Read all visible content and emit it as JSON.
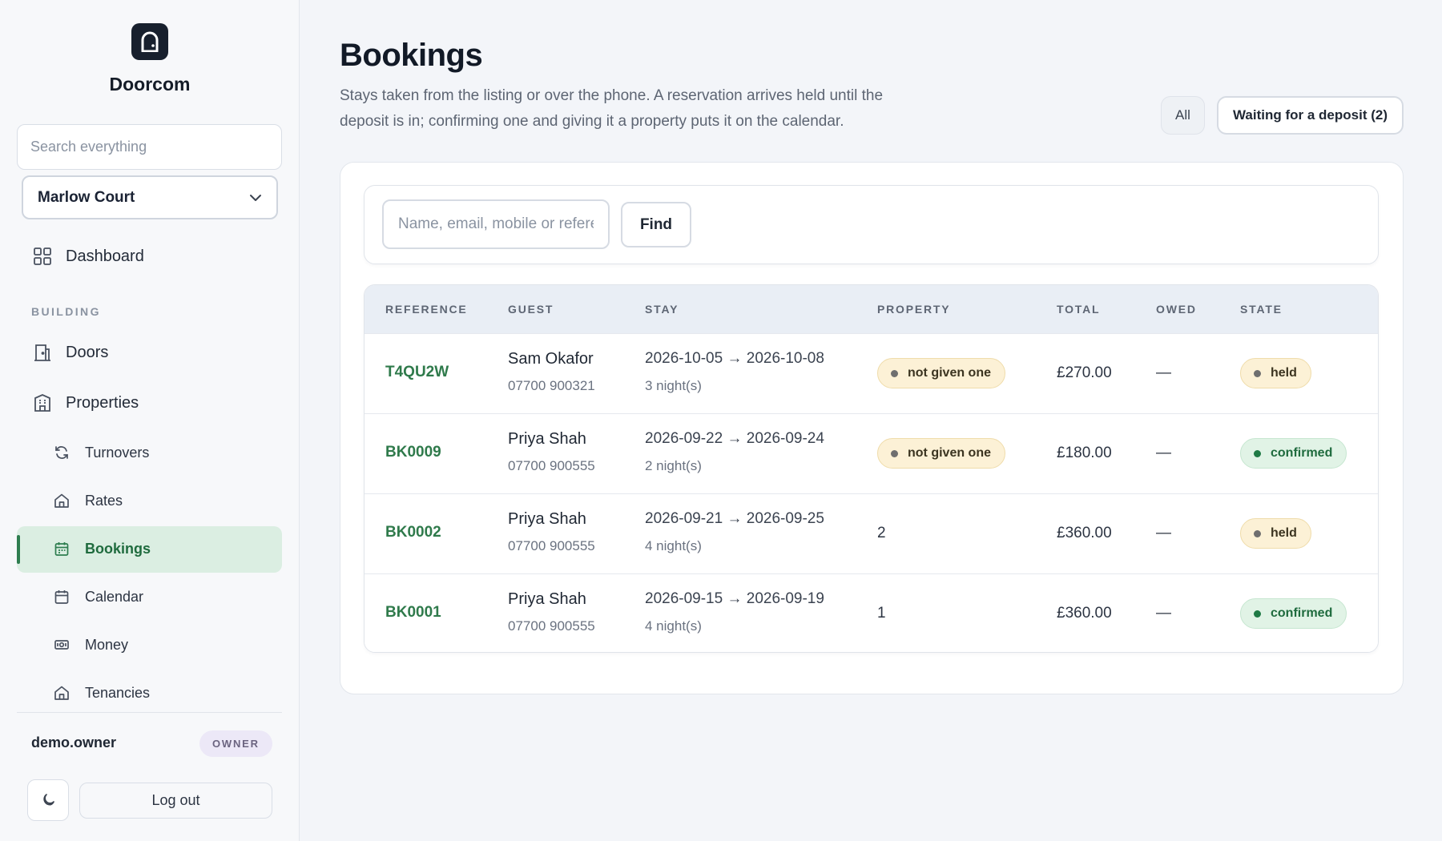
{
  "app": {
    "name": "Doorcom"
  },
  "sidebar": {
    "search_placeholder": "Search everything",
    "building": "Marlow Court",
    "dashboard": "Dashboard",
    "section_label": "BUILDING",
    "items": {
      "doors": "Doors",
      "properties": "Properties",
      "turnovers": "Turnovers",
      "rates": "Rates",
      "bookings": "Bookings",
      "calendar": "Calendar",
      "money": "Money",
      "tenancies": "Tenancies"
    },
    "user": {
      "name": "demo.owner",
      "role": "OWNER"
    },
    "logout_label": "Log out"
  },
  "page": {
    "title": "Bookings",
    "description": "Stays taken from the listing or over the phone. A reservation arrives held until the deposit is in; confirming one and giving it a property puts it on the calendar.",
    "filters": {
      "all": "All",
      "deposit": "Waiting for a deposit (2)"
    }
  },
  "search": {
    "placeholder": "Name, email, mobile or reference",
    "button": "Find"
  },
  "table": {
    "headers": {
      "reference": "REFERENCE",
      "guest": "GUEST",
      "stay": "STAY",
      "property": "PROPERTY",
      "total": "TOTAL",
      "owed": "OWED",
      "state": "STATE"
    },
    "rows": [
      {
        "reference": "T4QU2W",
        "guest": "Sam Okafor",
        "phone": "07700 900321",
        "dates": "2026-10-05 → 2026-10-08",
        "nights": "3 night(s)",
        "property": "not given one",
        "total": "£270.00",
        "owed": "—",
        "state": "held"
      },
      {
        "reference": "BK0009",
        "guest": "Priya Shah",
        "phone": "07700 900555",
        "dates": "2026-09-22 → 2026-09-24",
        "nights": "2 night(s)",
        "property": "not given one",
        "total": "£180.00",
        "owed": "—",
        "state": "confirmed"
      },
      {
        "reference": "BK0002",
        "guest": "Priya Shah",
        "phone": "07700 900555",
        "dates": "2026-09-21 → 2026-09-25",
        "nights": "4 night(s)",
        "property": "2",
        "total": "£360.00",
        "owed": "—",
        "state": "held"
      },
      {
        "reference": "BK0001",
        "guest": "Priya Shah",
        "phone": "07700 900555",
        "dates": "2026-09-15 → 2026-09-19",
        "nights": "4 night(s)",
        "property": "1",
        "total": "£360.00",
        "owed": "—",
        "state": "confirmed"
      }
    ]
  },
  "colors": {
    "accent_green": "#2f7a4b",
    "active_nav_bg": "#dbeee2",
    "held_badge_bg": "#fcf1d6",
    "confirmed_badge_bg": "#e1f3e6"
  },
  "icons": [
    "door-logo-icon",
    "chevron-down-icon",
    "grid-icon",
    "door-icon",
    "building-icon",
    "refresh-icon",
    "home-icon",
    "calendar-icon",
    "money-icon",
    "moon-icon"
  ]
}
